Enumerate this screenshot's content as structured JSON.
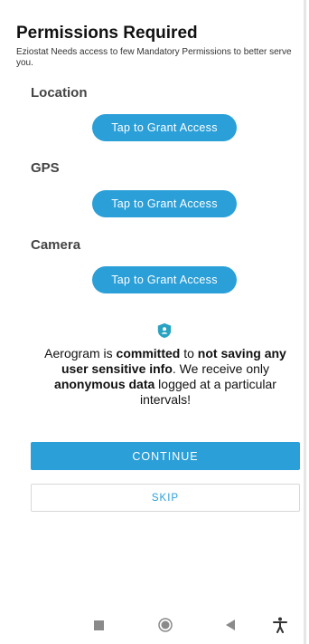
{
  "header": {
    "title": "Permissions Required",
    "subtitle": "Eziostat Needs access to few Mandatory Permissions to better serve you."
  },
  "permissions": [
    {
      "label": "Location",
      "button": "Tap to Grant Access"
    },
    {
      "label": "GPS",
      "button": "Tap to Grant Access"
    },
    {
      "label": "Camera",
      "button": "Tap to Grant Access"
    }
  ],
  "notice": {
    "icon": "shield-icon",
    "parts": [
      "Aerogram is ",
      "committed",
      " to ",
      "not saving any user sensitive info",
      ". We receive only ",
      "anonymous data",
      " logged at a particular intervals!"
    ]
  },
  "actions": {
    "continue_label": "CONTINUE",
    "skip_label": "SKIP"
  },
  "navbar": {
    "items": [
      "recents-icon",
      "home-icon",
      "back-icon",
      "accessibility-icon"
    ]
  },
  "colors": {
    "accent": "#2a9fd8",
    "shield": "#2aa3c2"
  }
}
